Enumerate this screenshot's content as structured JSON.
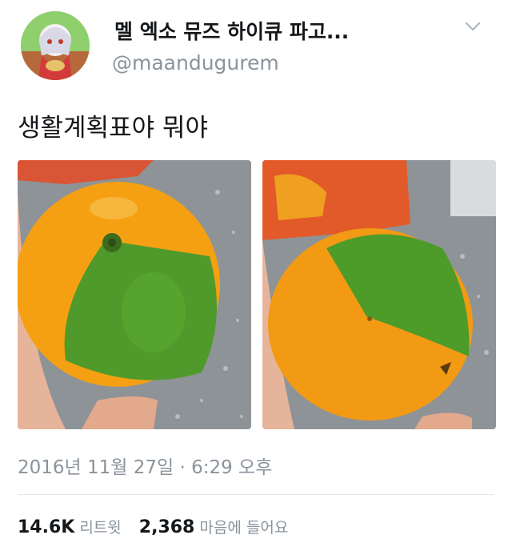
{
  "tweet": {
    "display_name": "멜 엑소 뮤즈 하이큐 파고...",
    "handle": "@maandugurem",
    "text": "생활계획표야 뭐야",
    "timestamp": "2016년 11월 27일 · 6:29 오후",
    "retweet_count": "14.6K",
    "retweet_label": "리트윗",
    "like_count": "2,368",
    "like_label": "마음에 들어요"
  },
  "icons": {
    "menu": "chevron-down-icon",
    "avatar": "anime-avatar"
  },
  "colors": {
    "name": "#14171a",
    "secondary": "#8a939c",
    "divider": "#e1e8ed"
  }
}
